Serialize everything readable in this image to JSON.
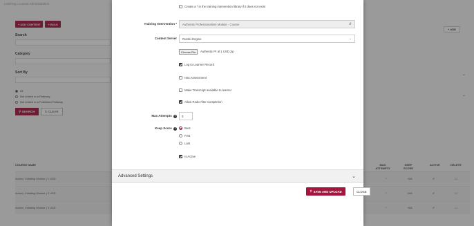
{
  "background": {
    "breadcrumb": "Learning / Course Administration",
    "buttons": {
      "add_content": "+ ADD CONTENT",
      "bulk": "+ BULK"
    },
    "filters": {
      "search_label": "Search",
      "category_label": "Category",
      "sort_by_label": "Sort By",
      "pathway_options": [
        "All",
        "Not Linked to a Pathway",
        "Not Linked to a Published Pathway"
      ],
      "search_button": "SEARCH",
      "clear_button": "CLEAR"
    },
    "add_button": "+ ADD",
    "table": {
      "headers": {
        "course_name": "COURSE NAME",
        "max_attempts": "MAX ATTEMPTS",
        "keep_score": "KEEP SCORE",
        "active": "ACTIVE",
        "delete": "DELETE"
      },
      "rows": [
        {
          "name": "Action | Initiating Module | 1 USD",
          "max_attempts": "*",
          "keep_score": "N/A"
        },
        {
          "name": "Action | Initiating Module | 2 USD",
          "max_attempts": "*",
          "keep_score": "N/A"
        },
        {
          "name": "Action | Initiating Module | 3 USD",
          "max_attempts": "*",
          "keep_score": "N/A"
        }
      ]
    }
  },
  "modal": {
    "create_star_label": "Create a * in the training intervention library if it does not exist",
    "training_intervention": {
      "label": "Training Intervention *",
      "value": "Authentic Professionalism Module - Course"
    },
    "content_server": {
      "label": "Content Server",
      "value": "Rustici Engine"
    },
    "file": {
      "button": "Choose File",
      "name": "Authentic Pr  al 1 USD.zip"
    },
    "checkboxes": [
      {
        "label": "Log to Learner Record",
        "checked": true
      },
      {
        "label": "Has Assessment",
        "checked": false
      },
      {
        "label": "Make Transcript available to learner",
        "checked": false
      },
      {
        "label": "Allow Redo After Completion",
        "checked": true
      }
    ],
    "max_attempts": {
      "label": "Max Attempts",
      "value": "0"
    },
    "keep_score": {
      "label": "Keep Score",
      "options": [
        {
          "label": "Best",
          "selected": true
        },
        {
          "label": "First",
          "selected": false
        },
        {
          "label": "Last",
          "selected": false
        }
      ]
    },
    "is_active": {
      "label": "Is Active",
      "checked": true
    },
    "advanced_settings": "Advanced Settings",
    "save_button": "SAVE AND UPLOAD",
    "close_button": "CLOSE"
  },
  "colors": {
    "accent": "#a5153e",
    "overlay": "#4a4a4a"
  }
}
